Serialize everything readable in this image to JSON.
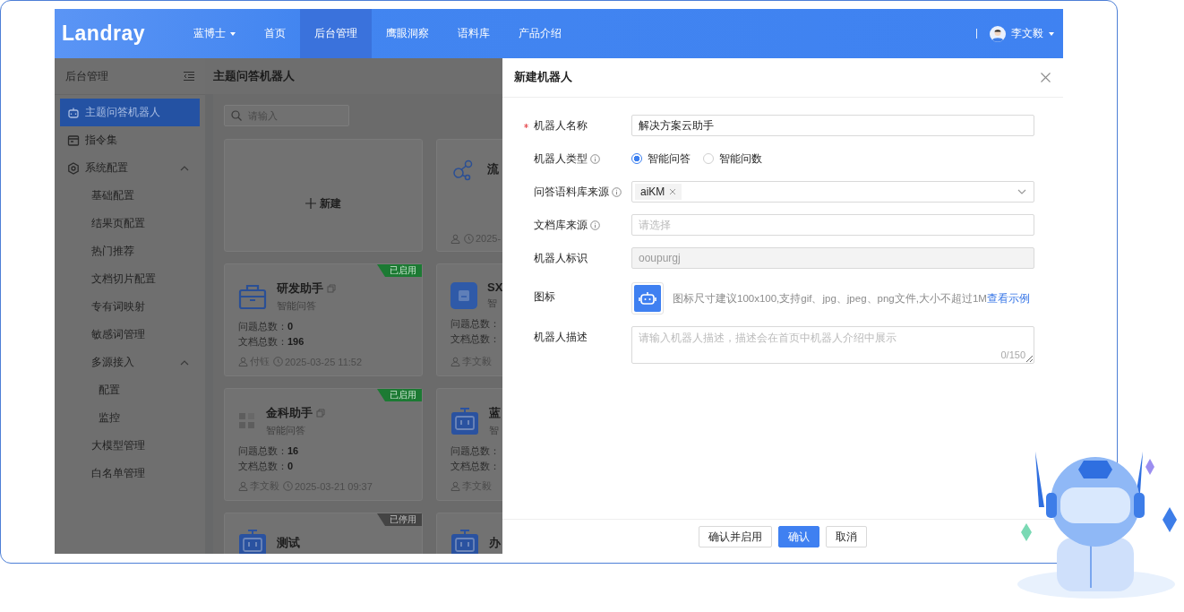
{
  "header": {
    "logo": "Landray",
    "nav": [
      {
        "label": "蓝博士",
        "dropdown": true,
        "selected": false
      },
      {
        "label": "首页",
        "selected": false
      },
      {
        "label": "后台管理",
        "selected": true
      },
      {
        "label": "鹰眼洞察",
        "selected": false
      },
      {
        "label": "语料库",
        "selected": false
      },
      {
        "label": "产品介绍",
        "selected": false
      }
    ],
    "user": {
      "name": "李文毅"
    }
  },
  "sidebar": {
    "title": "后台管理",
    "items": [
      {
        "label": "主题问答机器人",
        "selected": true
      },
      {
        "label": "指令集",
        "selected": false
      },
      {
        "label": "系统配置",
        "selected": false,
        "expanded": true,
        "children": [
          {
            "label": "基础配置",
            "selected": false
          },
          {
            "label": "结果页配置",
            "selected": false
          },
          {
            "label": "热门推荐",
            "selected": false
          },
          {
            "label": "文档切片配置",
            "selected": false
          },
          {
            "label": "专有词映射",
            "selected": false
          },
          {
            "label": "敏感词管理",
            "selected": false
          },
          {
            "label": "多源接入",
            "selected": false,
            "expanded": true,
            "children": [
              {
                "label": "配置",
                "selected": false
              },
              {
                "label": "监控",
                "selected": false
              }
            ]
          },
          {
            "label": "大模型管理",
            "selected": false
          },
          {
            "label": "白名单管理",
            "selected": false
          }
        ]
      }
    ]
  },
  "main": {
    "title": "主题问答机器人",
    "search": {
      "placeholder": "请输入"
    },
    "cards": [
      {
        "kind": "new",
        "label": "新建"
      },
      {
        "kind": "bot",
        "title": "流",
        "time": "2025-"
      },
      {
        "kind": "bot",
        "title": "研发助手",
        "copyable": true,
        "type": "智能问答",
        "status": "已启用",
        "enabled": true,
        "stats": [
          {
            "label": "问题总数：",
            "value": "0"
          },
          {
            "label": "文档总数：",
            "value": "196"
          }
        ],
        "user": "付钰",
        "time": "2025-03-25 11:52"
      },
      {
        "kind": "bot",
        "title": "SX",
        "type": "智",
        "stats": [
          {
            "label": "问题总数："
          },
          {
            "label": "文档总数："
          }
        ],
        "user": "李文毅"
      },
      {
        "kind": "bot",
        "title": "金科助手",
        "copyable": true,
        "type": "智能问答",
        "status": "已启用",
        "enabled": true,
        "stats": [
          {
            "label": "问题总数：",
            "value": "16"
          },
          {
            "label": "文档总数：",
            "value": "0"
          }
        ],
        "user": "李文毅",
        "time": "2025-03-21 09:37"
      },
      {
        "kind": "bot",
        "title": "蓝",
        "type": "智",
        "stats": [
          {
            "label": "问题总数："
          },
          {
            "label": "文档总数："
          }
        ],
        "user": "李文毅"
      },
      {
        "kind": "bot",
        "title": "测试",
        "status": "已停用",
        "enabled": false
      },
      {
        "kind": "bot",
        "title": "办"
      }
    ]
  },
  "drawer": {
    "title": "新建机器人",
    "form": [
      {
        "kind": "text",
        "label": "机器人名称",
        "required": true,
        "disabled": false,
        "value": "解决方案云助手"
      },
      {
        "kind": "radio",
        "label": "机器人类型",
        "info": true,
        "options": [
          {
            "label": "智能问答",
            "selected": true
          },
          {
            "label": "智能问数",
            "selected": false
          }
        ]
      },
      {
        "kind": "tags",
        "label": "问答语料库来源",
        "info": true,
        "tags": [
          "aiKM"
        ]
      },
      {
        "kind": "select",
        "label": "文档库来源",
        "info": true,
        "placeholder": "请选择"
      },
      {
        "kind": "text",
        "label": "机器人标识",
        "disabled": true,
        "value": "ooupurgj"
      },
      {
        "kind": "icon",
        "label": "图标",
        "hint": "图标尺寸建议100x100,支持gif、jpg、jpeg、png文件,大小不超过1M",
        "link": "查看示例"
      },
      {
        "kind": "textarea",
        "label": "机器人描述",
        "placeholder": "请输入机器人描述，描述会在首页中机器人介绍中展示",
        "counter": "0/150"
      }
    ],
    "buttons": [
      {
        "label": "确认并启用",
        "primary": false
      },
      {
        "label": "确认",
        "primary": true
      },
      {
        "label": "取消",
        "primary": false
      }
    ]
  }
}
